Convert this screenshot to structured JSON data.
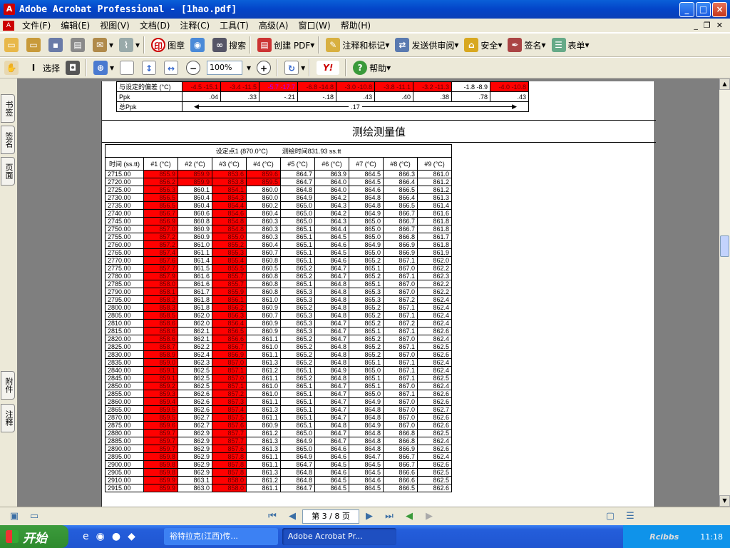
{
  "window": {
    "title": "Adobe Acrobat Professional - [1hao.pdf]",
    "min": "_",
    "max": "□",
    "close": "×"
  },
  "menu": [
    "文件(F)",
    "编辑(E)",
    "视图(V)",
    "文档(D)",
    "注释(C)",
    "工具(T)",
    "高级(A)",
    "窗口(W)",
    "帮助(H)"
  ],
  "toolbar1": {
    "stamp": "图章",
    "search": "搜索",
    "create_pdf": "创建 PDF",
    "comment": "注释和标记",
    "send_review": "发送供审阅",
    "secure": "安全",
    "sign": "签名",
    "forms": "表单"
  },
  "toolbar2": {
    "select": "选择",
    "zoom": "100%",
    "help": "帮助"
  },
  "side_tabs": [
    "书签",
    "签名",
    "页面",
    "附件",
    "注释"
  ],
  "top_rows": {
    "deviation_label": "与设定的偏差 (°C)",
    "deviation": [
      "-4.5  -15.1",
      "-3.4  -11.5",
      "-5.7  -17.7",
      "-6.8  -14.8",
      "-3.0  -10.8",
      "-3.8  -11.1",
      "-3.2  -11.3",
      "-1.8  -8.9",
      "-4.0  -10.8"
    ],
    "ppk_label": "Ppk",
    "ppk": [
      ".04",
      ".33",
      "-.21",
      "-.18",
      ".43",
      ".40",
      ".38",
      ".78",
      ".43"
    ],
    "total_ppk_label": "总Ppk",
    "total_ppk": ".17"
  },
  "section_title": "测绘测量值",
  "table": {
    "setpoint": "设定点1 (870.0°C)",
    "survey_time": "测绘时间831.93 ss.tt",
    "columns": [
      "时间 (ss.tt)",
      "#1 (°C)",
      "#2 (°C)",
      "#3 (°C)",
      "#4 (°C)",
      "#5 (°C)",
      "#6 (°C)",
      "#7 (°C)",
      "#8 (°C)",
      "#9 (°C)"
    ],
    "rows": [
      [
        "2715.00",
        "855.9",
        "859.9",
        "853.6",
        "859.6",
        "864.7",
        "863.9",
        "864.5",
        "866.3",
        "861.0"
      ],
      [
        "2720.00",
        "856.2",
        "859.9",
        "853.8",
        "859.5",
        "864.7",
        "864.0",
        "864.5",
        "866.4",
        "861.2"
      ],
      [
        "2725.00",
        "856.3",
        "860.1",
        "854.1",
        "860.0",
        "864.8",
        "864.0",
        "864.6",
        "866.5",
        "861.2"
      ],
      [
        "2730.00",
        "856.5",
        "860.4",
        "854.3",
        "860.0",
        "864.9",
        "864.2",
        "864.8",
        "866.4",
        "861.3"
      ],
      [
        "2735.00",
        "856.5",
        "860.4",
        "854.4",
        "860.2",
        "865.0",
        "864.3",
        "864.8",
        "866.5",
        "861.4"
      ],
      [
        "2740.00",
        "856.7",
        "860.6",
        "854.6",
        "860.4",
        "865.0",
        "864.2",
        "864.9",
        "866.7",
        "861.6"
      ],
      [
        "2745.00",
        "856.9",
        "860.8",
        "854.8",
        "860.3",
        "865.0",
        "864.3",
        "865.0",
        "866.7",
        "861.8"
      ],
      [
        "2750.00",
        "857.0",
        "860.9",
        "854.8",
        "860.3",
        "865.1",
        "864.4",
        "865.0",
        "866.7",
        "861.8"
      ],
      [
        "2755.00",
        "857.2",
        "860.9",
        "855.0",
        "860.3",
        "865.1",
        "864.5",
        "865.0",
        "866.8",
        "861.7"
      ],
      [
        "2760.00",
        "857.2",
        "861.0",
        "855.2",
        "860.4",
        "865.1",
        "864.6",
        "864.9",
        "866.9",
        "861.8"
      ],
      [
        "2765.00",
        "857.4",
        "861.1",
        "855.3",
        "860.7",
        "865.1",
        "864.5",
        "865.0",
        "866.9",
        "861.9"
      ],
      [
        "2770.00",
        "857.6",
        "861.4",
        "855.4",
        "860.8",
        "865.1",
        "864.6",
        "865.2",
        "867.1",
        "862.0"
      ],
      [
        "2775.00",
        "857.7",
        "861.5",
        "855.5",
        "860.5",
        "865.2",
        "864.7",
        "865.1",
        "867.0",
        "862.2"
      ],
      [
        "2780.00",
        "857.9",
        "861.6",
        "855.7",
        "860.8",
        "865.2",
        "864.7",
        "865.2",
        "867.1",
        "862.3"
      ],
      [
        "2785.00",
        "858.0",
        "861.6",
        "855.7",
        "860.8",
        "865.1",
        "864.8",
        "865.1",
        "867.0",
        "862.2"
      ],
      [
        "2790.00",
        "858.1",
        "861.7",
        "855.9",
        "860.8",
        "865.3",
        "864.8",
        "865.3",
        "867.0",
        "862.2"
      ],
      [
        "2795.00",
        "858.2",
        "861.8",
        "856.1",
        "861.0",
        "865.3",
        "864.8",
        "865.3",
        "867.2",
        "862.4"
      ],
      [
        "2800.00",
        "858.3",
        "861.8",
        "856.2",
        "860.9",
        "865.2",
        "864.8",
        "865.2",
        "867.1",
        "862.4"
      ],
      [
        "2805.00",
        "858.5",
        "862.0",
        "856.3",
        "860.7",
        "865.3",
        "864.8",
        "865.2",
        "867.1",
        "862.4"
      ],
      [
        "2810.00",
        "858.6",
        "862.0",
        "856.4",
        "860.9",
        "865.3",
        "864.7",
        "865.2",
        "867.2",
        "862.4"
      ],
      [
        "2815.00",
        "858.6",
        "862.1",
        "856.5",
        "860.9",
        "865.3",
        "864.7",
        "865.1",
        "867.1",
        "862.6"
      ],
      [
        "2820.00",
        "858.6",
        "862.1",
        "856.6",
        "861.1",
        "865.2",
        "864.7",
        "865.2",
        "867.0",
        "862.4"
      ],
      [
        "2825.00",
        "858.7",
        "862.2",
        "856.7",
        "861.0",
        "865.2",
        "864.8",
        "865.2",
        "867.1",
        "862.5"
      ],
      [
        "2830.00",
        "858.9",
        "862.4",
        "856.9",
        "861.1",
        "865.2",
        "864.8",
        "865.2",
        "867.0",
        "862.6"
      ],
      [
        "2835.00",
        "859.0",
        "862.3",
        "857.0",
        "861.3",
        "865.2",
        "864.8",
        "865.1",
        "867.1",
        "862.4"
      ],
      [
        "2840.00",
        "859.1",
        "862.5",
        "857.1",
        "861.2",
        "865.1",
        "864.9",
        "865.0",
        "867.1",
        "862.4"
      ],
      [
        "2845.00",
        "859.1",
        "862.5",
        "857.0",
        "861.1",
        "865.2",
        "864.8",
        "865.1",
        "867.1",
        "862.5"
      ],
      [
        "2850.00",
        "859.2",
        "862.5",
        "857.1",
        "861.0",
        "865.1",
        "864.7",
        "865.1",
        "867.0",
        "862.4"
      ],
      [
        "2855.00",
        "859.3",
        "862.6",
        "857.2",
        "861.0",
        "865.1",
        "864.7",
        "865.0",
        "867.1",
        "862.6"
      ],
      [
        "2860.00",
        "859.4",
        "862.6",
        "857.3",
        "861.1",
        "865.1",
        "864.7",
        "864.9",
        "867.0",
        "862.6"
      ],
      [
        "2865.00",
        "859.5",
        "862.6",
        "857.4",
        "861.3",
        "865.1",
        "864.7",
        "864.8",
        "867.0",
        "862.7"
      ],
      [
        "2870.00",
        "859.5",
        "862.7",
        "857.5",
        "861.1",
        "865.1",
        "864.7",
        "864.8",
        "867.0",
        "862.6"
      ],
      [
        "2875.00",
        "859.6",
        "862.7",
        "857.6",
        "860.9",
        "865.1",
        "864.8",
        "864.9",
        "867.0",
        "862.6"
      ],
      [
        "2880.00",
        "859.7",
        "862.9",
        "857.7",
        "861.2",
        "865.0",
        "864.7",
        "864.8",
        "866.8",
        "862.5"
      ],
      [
        "2885.00",
        "859.7",
        "862.9",
        "857.7",
        "861.3",
        "864.9",
        "864.7",
        "864.8",
        "866.8",
        "862.4"
      ],
      [
        "2890.00",
        "859.7",
        "862.9",
        "857.6",
        "861.3",
        "865.0",
        "864.6",
        "864.8",
        "866.9",
        "862.6"
      ],
      [
        "2895.00",
        "859.8",
        "862.9",
        "857.8",
        "861.1",
        "864.9",
        "864.6",
        "864.7",
        "866.7",
        "862.4"
      ],
      [
        "2900.00",
        "859.8",
        "862.9",
        "857.8",
        "861.1",
        "864.7",
        "864.5",
        "864.5",
        "866.7",
        "862.6"
      ],
      [
        "2905.00",
        "859.8",
        "862.9",
        "857.8",
        "861.3",
        "864.8",
        "864.6",
        "864.5",
        "866.6",
        "862.5"
      ],
      [
        "2910.00",
        "859.9",
        "863.1",
        "858.0",
        "861.2",
        "864.8",
        "864.5",
        "864.6",
        "866.6",
        "862.5"
      ],
      [
        "2915.00",
        "859.9",
        "863.0",
        "858.0",
        "861.1",
        "864.7",
        "864.5",
        "864.5",
        "866.5",
        "862.6"
      ]
    ]
  },
  "status": {
    "page": "第 3 / 8 页"
  },
  "taskbar": {
    "start": "开始",
    "task1": "裕特拉克(江西)传...",
    "task2": "Adobe Acrobat Pr...",
    "clock": "11:18",
    "watermark": "Rcibbs"
  }
}
